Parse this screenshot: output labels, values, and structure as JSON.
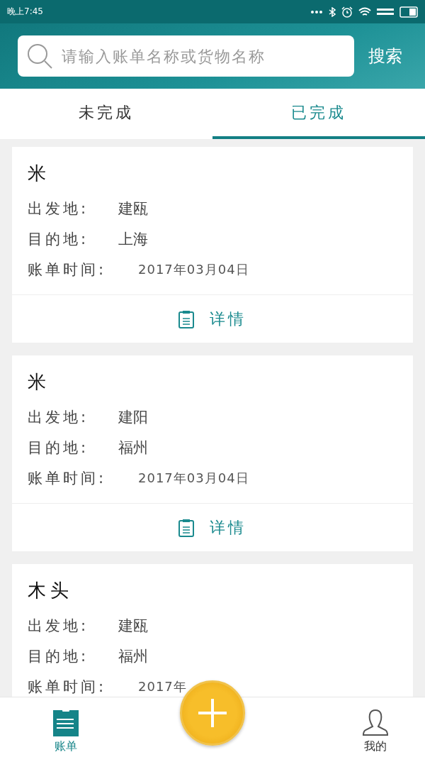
{
  "status_bar": {
    "time": "晚上7:45"
  },
  "search": {
    "placeholder": "请输入账单名称或货物名称",
    "button": "搜索"
  },
  "tabs": [
    {
      "label": "未完成",
      "selected": false
    },
    {
      "label": "已完成",
      "selected": true
    }
  ],
  "bills": [
    {
      "name": "米",
      "origin_label": "出发地:",
      "origin": "建瓯",
      "dest_label": "目的地:",
      "dest": "上海",
      "time_label": "账单时间:",
      "time": "2017年03月04日",
      "details": "详情"
    },
    {
      "name": "米",
      "origin_label": "出发地:",
      "origin": "建阳",
      "dest_label": "目的地:",
      "dest": "福州",
      "time_label": "账单时间:",
      "time": "2017年03月04日",
      "details": "详情"
    },
    {
      "name": "木头",
      "origin_label": "出发地:",
      "origin": "建瓯",
      "dest_label": "目的地:",
      "dest": "福州",
      "time_label": "账单时间:",
      "time": "2017年"
    }
  ],
  "bottom_nav": [
    {
      "label": "账单",
      "kind": "bills",
      "selected": true
    },
    {
      "label": "我的",
      "kind": "profile",
      "selected": false
    }
  ]
}
